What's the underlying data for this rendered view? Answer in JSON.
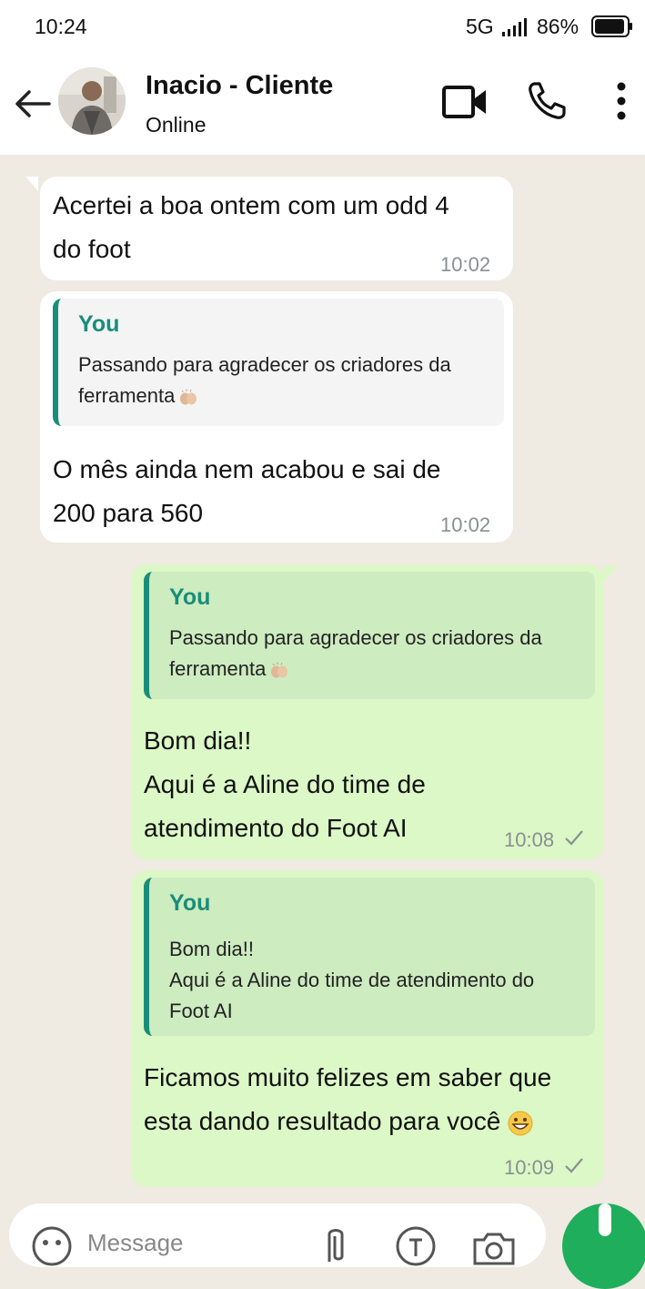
{
  "status": {
    "time": "10:24",
    "network": "5G",
    "battery": "86%"
  },
  "header": {
    "contact_name": "Inacio - Cliente",
    "contact_status": "Online"
  },
  "messages": [
    {
      "direction": "in",
      "text": " Acertei a boa ontem com um odd 4\ndo foot",
      "time": "10:02"
    },
    {
      "direction": "in",
      "quote_author": "You",
      "quote_text": "Passando para agradecer os criadores da\nferramenta",
      "text": " O mês ainda nem acabou e sai de\n200 para 560",
      "time": "10:02"
    },
    {
      "direction": "out",
      "quote_author": "You",
      "quote_text": "Passando para agradecer os criadores da\nferramenta",
      "text": " Bom dia!!\nAqui é a Aline do time de\natendimento do Foot AI",
      "time": "10:08"
    },
    {
      "direction": "out",
      "quote_author": "You",
      "quote_text": "Bom dia!!\nAqui é a Aline do time de atendimento do\nFoot AI",
      "text": " Ficamos muito felizes em saber que\nesta dando resultado para você",
      "time": "10:09"
    }
  ],
  "composer": {
    "placeholder": "Message"
  },
  "icons": {
    "back": "arrow-left-icon",
    "video": "video-camera-icon",
    "call": "phone-icon",
    "menu": "more-vertical-icon",
    "emoji": "emoji-icon",
    "attach": "paperclip-icon",
    "camera": "camera-icon",
    "mic": "mic-icon",
    "clap": "clapping-hands-emoji",
    "grin": "grinning-face-emoji",
    "check": "single-check-icon"
  },
  "colors": {
    "chat_bg": "#efeae2",
    "outgoing": "#dbf8c6",
    "incoming": "#ffffff",
    "accent": "#1a8d7a",
    "mic": "#1fae5b"
  }
}
